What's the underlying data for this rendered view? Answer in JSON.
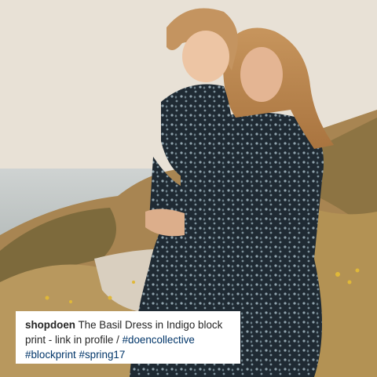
{
  "post": {
    "username": "shopdoen",
    "caption_text": "The Basil Dress in Indigo block print - link in profile /",
    "hashtags": [
      "#doencollective",
      "#blockprint",
      "#spring17"
    ]
  },
  "colors": {
    "caption_background": "#ffffff",
    "text": "#262626",
    "hashtag": "#003569"
  },
  "photo": {
    "description_icon": "photo-mother-child-coast"
  }
}
